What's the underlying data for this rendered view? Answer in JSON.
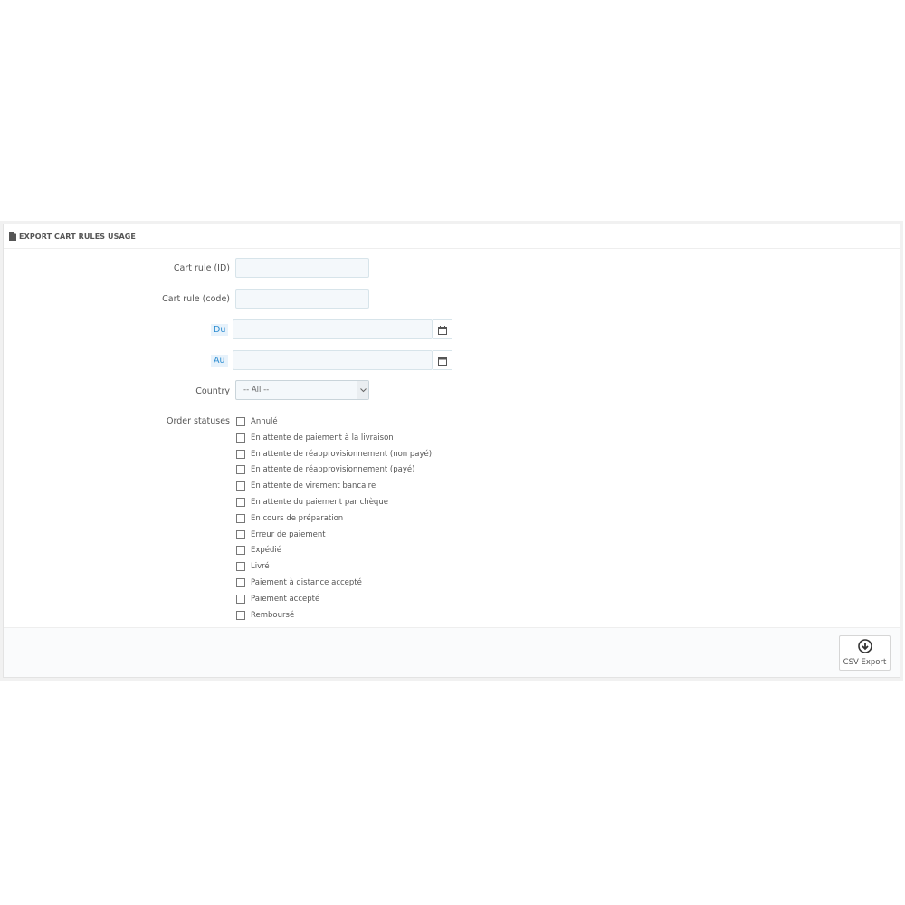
{
  "panel": {
    "title": "EXPORT CART RULES USAGE"
  },
  "form": {
    "cart_rule_id_label": "Cart rule (ID)",
    "cart_rule_id_value": "",
    "cart_rule_code_label": "Cart rule (code)",
    "cart_rule_code_value": "",
    "date_from_label": "Du",
    "date_from_value": "",
    "date_to_label": "Au",
    "date_to_value": "",
    "country_label": "Country",
    "country_selected": "-- All --",
    "order_statuses_label": "Order statuses",
    "order_statuses": [
      "Annulé",
      "En attente de paiement à la livraison",
      "En attente de réapprovisionnement (non payé)",
      "En attente de réapprovisionnement (payé)",
      "En attente de virement bancaire",
      "En attente du paiement par chèque",
      "En cours de préparation",
      "Erreur de paiement",
      "Expédié",
      "Livré",
      "Paiement à distance accepté",
      "Paiement accepté",
      "Remboursé"
    ]
  },
  "footer": {
    "csv_export_label": "CSV Export"
  },
  "icons": {
    "heading": "file-icon",
    "calendar": "calendar-icon",
    "select_arrow": "chevron-down-icon",
    "export": "download-circle-icon"
  }
}
